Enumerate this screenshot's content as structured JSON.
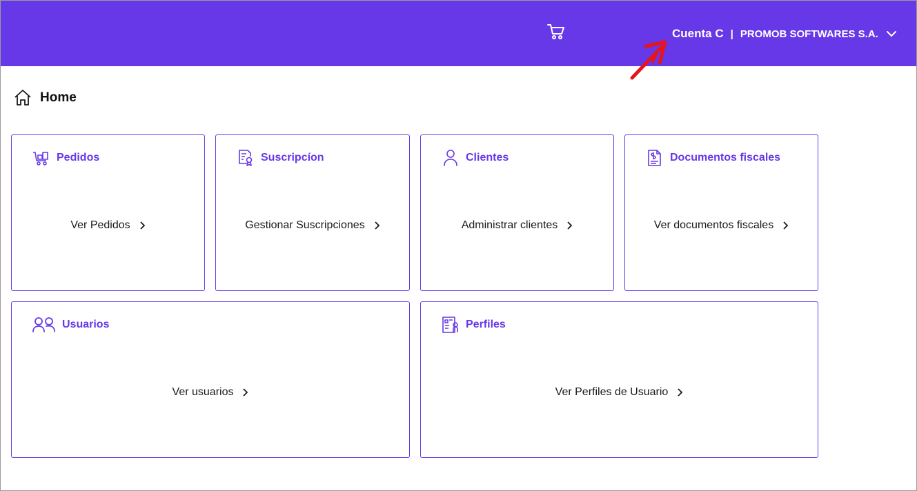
{
  "header": {
    "account_name": "Cuenta C",
    "separator": "|",
    "company": "PROMOB SOFTWARES S.A.",
    "cart_icon": "cart-icon",
    "dropdown_icon": "chevron-down-icon",
    "brand_color": "#6638e8"
  },
  "breadcrumb": {
    "icon": "home-icon",
    "label": "Home"
  },
  "cards": [
    {
      "title": "Pedidos",
      "link": "Ver Pedidos",
      "icon": "cart-boxes-icon"
    },
    {
      "title": "Suscripcíon",
      "link": "Gestionar Suscripciones",
      "icon": "certificate-icon"
    },
    {
      "title": "Clientes",
      "link": "Administrar clientes",
      "icon": "user-icon"
    },
    {
      "title": "Documentos fiscales",
      "link": "Ver documentos fiscales",
      "icon": "invoice-icon"
    },
    {
      "title": "Usuarios",
      "link": "Ver usuarios",
      "icon": "users-icon"
    },
    {
      "title": "Perfiles",
      "link": "Ver Perfiles de Usuario",
      "icon": "profile-badge-icon"
    }
  ],
  "annotation": {
    "color": "#e8141c",
    "icon": "red-arrow"
  }
}
